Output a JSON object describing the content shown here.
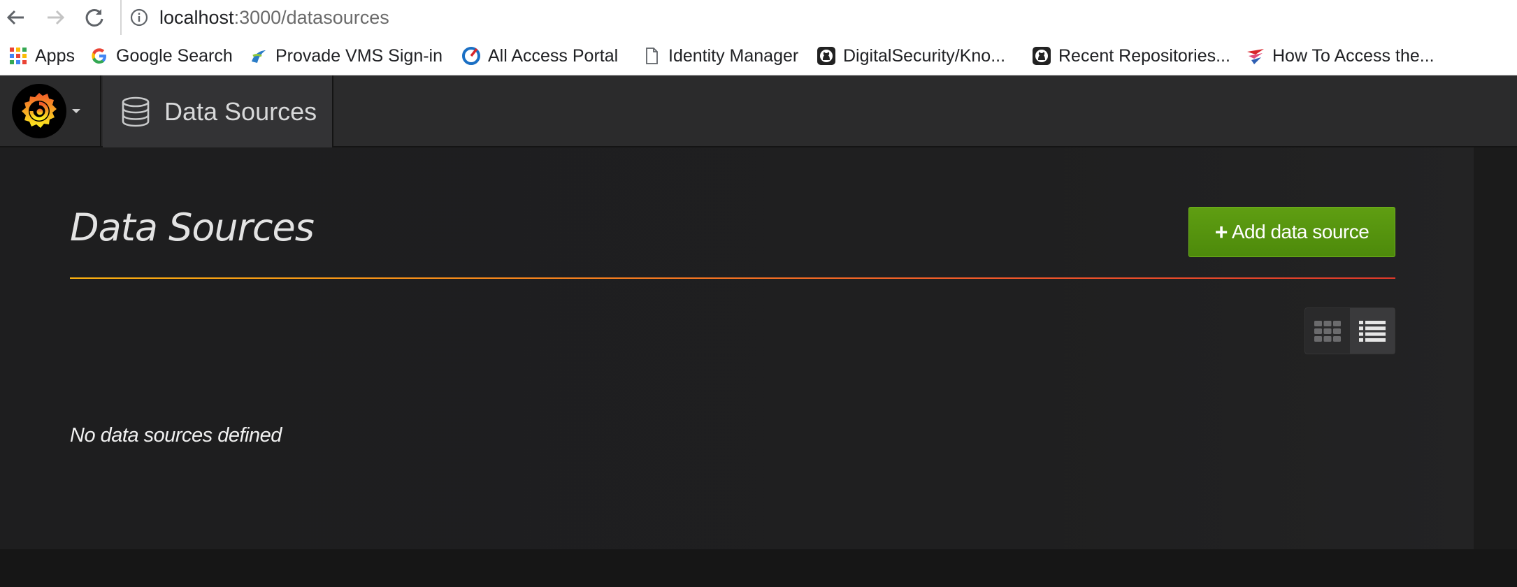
{
  "browser": {
    "url_host": "localhost",
    "url_path": ":3000/datasources"
  },
  "bookmarks": [
    {
      "label": "Apps",
      "icon": "apps-grid-icon"
    },
    {
      "label": "Google Search",
      "icon": "google-icon"
    },
    {
      "label": "Provade VMS Sign-in",
      "icon": "provade-icon"
    },
    {
      "label": "All Access Portal",
      "icon": "portal-icon"
    },
    {
      "label": "Identity Manager",
      "icon": "document-icon"
    },
    {
      "label": "DigitalSecurity/Kno...",
      "icon": "github-icon"
    },
    {
      "label": "Recent Repositories...",
      "icon": "github-icon"
    },
    {
      "label": "How To Access the...",
      "icon": "bird-icon"
    }
  ],
  "navbar": {
    "section_title": "Data Sources"
  },
  "page": {
    "title": "Data Sources",
    "add_button": "Add data source",
    "add_button_icon": "+",
    "empty_message": "No data sources defined"
  },
  "colors": {
    "accent_green": "#5a9a12",
    "divider_start": "#ffb30f",
    "divider_end": "#e13a2a",
    "background": "#1f1f20"
  }
}
